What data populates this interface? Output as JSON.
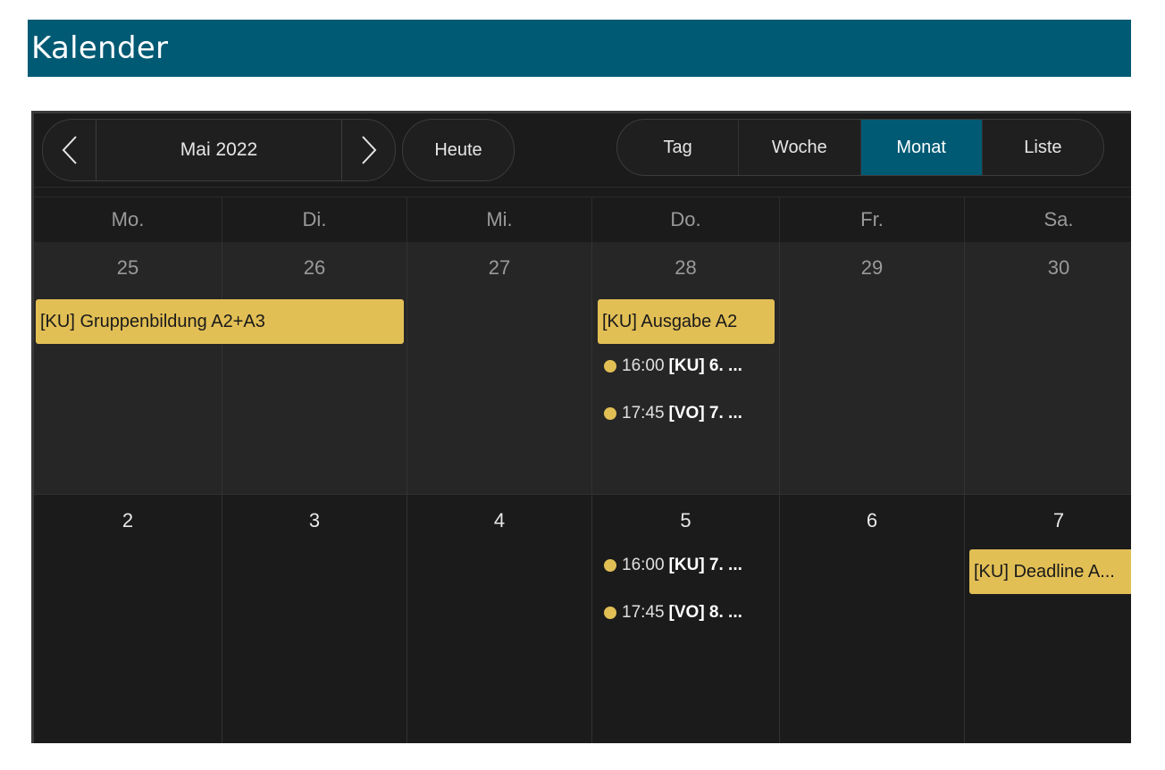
{
  "header": {
    "title": "Kalender"
  },
  "toolbar": {
    "month_title": "Mai 2022",
    "today_label": "Heute",
    "views": [
      {
        "label": "Tag",
        "active": false
      },
      {
        "label": "Woche",
        "active": false
      },
      {
        "label": "Monat",
        "active": true
      },
      {
        "label": "Liste",
        "active": false
      }
    ],
    "prev_icon": "chevron-left-icon",
    "next_icon": "chevron-right-icon"
  },
  "weekdays": [
    "Mo.",
    "Di.",
    "Mi.",
    "Do.",
    "Fr.",
    "Sa."
  ],
  "weeks": [
    {
      "days": [
        "25",
        "26",
        "27",
        "28",
        "29",
        "30"
      ],
      "events": {
        "gruppenbildung": "[KU] Gruppenbildung A2+A3",
        "ausgabe": "[KU] Ausgabe A2",
        "timed": [
          {
            "time": "16:00",
            "title": "[KU] 6. ..."
          },
          {
            "time": "17:45",
            "title": "[VO] 7. ..."
          }
        ]
      }
    },
    {
      "days": [
        "2",
        "3",
        "4",
        "5",
        "6",
        "7"
      ],
      "events": {
        "deadline": "[KU] Deadline A...",
        "timed": [
          {
            "time": "16:00",
            "title": "[KU] 7. ..."
          },
          {
            "time": "17:45",
            "title": "[VO] 8. ..."
          }
        ]
      }
    }
  ],
  "colors": {
    "brand": "#015a74",
    "event": "#e2bf55",
    "background": "#1b1b1b"
  }
}
